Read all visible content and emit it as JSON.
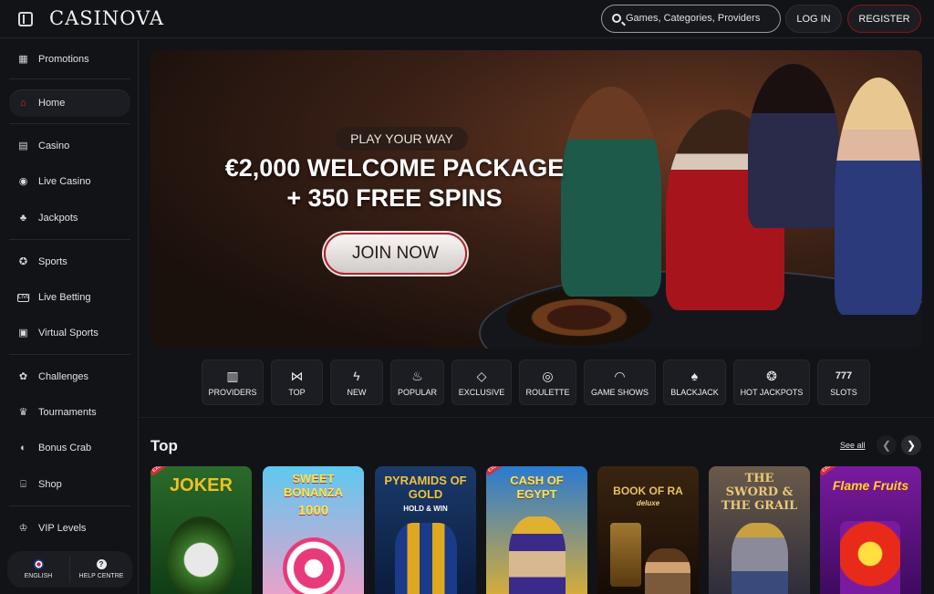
{
  "header": {
    "logo": "CASINOVA",
    "search_placeholder": "Games, Categories, Providers",
    "login_label": "LOG IN",
    "register_label": "REGISTER"
  },
  "sidebar": {
    "items": [
      {
        "label": "Promotions",
        "icon": "gift-icon"
      },
      {
        "label": "Home",
        "icon": "home-icon",
        "active": true
      },
      {
        "label": "Casino",
        "icon": "slot-machine-icon"
      },
      {
        "label": "Live Casino",
        "icon": "live-dealer-icon"
      },
      {
        "label": "Jackpots",
        "icon": "clover-icon"
      },
      {
        "label": "Sports",
        "icon": "soccer-ball-icon"
      },
      {
        "label": "Live Betting",
        "icon": "live-badge-icon"
      },
      {
        "label": "Virtual Sports",
        "icon": "virtual-icon"
      },
      {
        "label": "Challenges",
        "icon": "medal-icon"
      },
      {
        "label": "Tournaments",
        "icon": "trophy-icon"
      },
      {
        "label": "Bonus Crab",
        "icon": "claw-icon"
      },
      {
        "label": "Shop",
        "icon": "shop-icon"
      },
      {
        "label": "VIP Levels",
        "icon": "crown-icon"
      }
    ],
    "language_label": "ENGLISH",
    "help_label": "HELP CENTRE"
  },
  "hero": {
    "tagline": "PLAY YOUR WAY",
    "headline_line1": "€2,000 WELCOME PACKAGE",
    "headline_line2": "+ 350 FREE SPINS",
    "cta_label": "JOIN NOW"
  },
  "categories": [
    {
      "label": "PROVIDERS",
      "icon": "book-icon"
    },
    {
      "label": "TOP",
      "icon": "bowtie-icon"
    },
    {
      "label": "NEW",
      "icon": "lightning-icon"
    },
    {
      "label": "POPULAR",
      "icon": "flame-icon"
    },
    {
      "label": "EXCLUSIVE",
      "icon": "diamond-icon"
    },
    {
      "label": "ROULETTE",
      "icon": "roulette-icon"
    },
    {
      "label": "GAME SHOWS",
      "icon": "mask-icon"
    },
    {
      "label": "BLACKJACK",
      "icon": "cards-icon"
    },
    {
      "label": "HOT JACKPOTS",
      "icon": "fire-coin-icon"
    },
    {
      "label": "SLOTS",
      "icon": "sevens-icon"
    }
  ],
  "top_section": {
    "title": "Top",
    "see_all_label": "See all"
  },
  "games": [
    {
      "title": "JOKER",
      "subtitle": "",
      "badge": "EXCLUSIVE",
      "colors": [
        "#2a6a2a",
        "#0e3a14"
      ]
    },
    {
      "title": "SWEET BONANZA",
      "subtitle": "1000",
      "badge": "",
      "colors": [
        "#5ec8f0",
        "#f0a0c8"
      ]
    },
    {
      "title": "PYRAMIDS OF GOLD",
      "subtitle": "HOLD & WIN",
      "badge": "",
      "colors": [
        "#1a3a6a",
        "#0a1a3a"
      ]
    },
    {
      "title": "CASH OF EGYPT",
      "subtitle": "",
      "badge": "EXCLUSIVE",
      "colors": [
        "#2a7ad0",
        "#e0b030"
      ]
    },
    {
      "title": "BOOK OF RA",
      "subtitle": "deluxe",
      "badge": "",
      "colors": [
        "#3a2410",
        "#120a04"
      ]
    },
    {
      "title": "THE SWORD & THE GRAIL",
      "subtitle": "",
      "badge": "",
      "colors": [
        "#6a5a4a",
        "#2a2a3a"
      ]
    },
    {
      "title": "Flame Fruits",
      "subtitle": "",
      "badge": "EXCLUSIVE",
      "colors": [
        "#7a1aa0",
        "#3a0a5a"
      ]
    }
  ]
}
